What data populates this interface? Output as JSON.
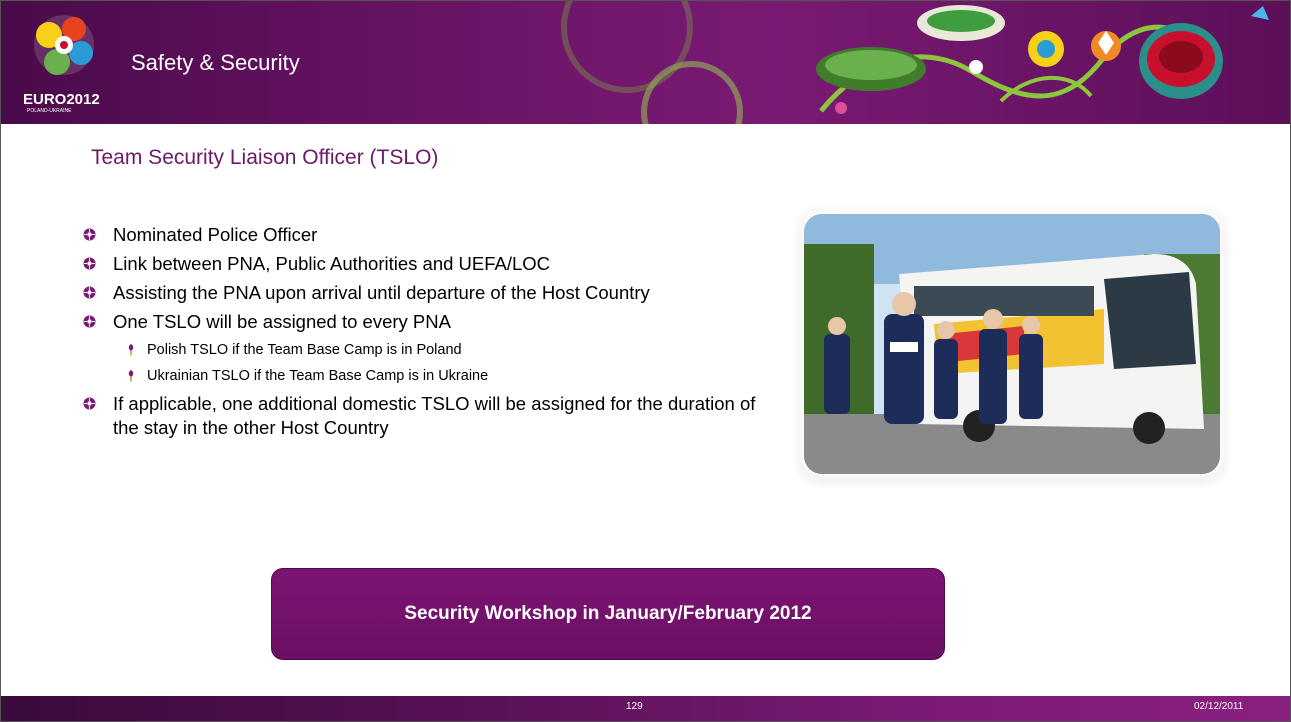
{
  "header": {
    "logo": {
      "name": "EURO2012",
      "subtitle": "POLAND-UKRAINE",
      "icon": "euro2012-logo"
    },
    "title": "Safety & Security"
  },
  "subtitle": "Team Security Liaison Officer (TSLO)",
  "bullets": [
    {
      "text": "Nominated Police Officer"
    },
    {
      "text": "Link between PNA, Public Authorities and UEFA/LOC"
    },
    {
      "text": "Assisting the PNA upon arrival until departure of the Host Country"
    },
    {
      "text": "One TSLO will be assigned to every PNA",
      "sub": [
        "Polish TSLO if the Team Base Camp is in Poland",
        "Ukrainian TSLO if the Team Base Camp is in Ukraine"
      ]
    },
    {
      "text": "If applicable, one additional domestic TSLO will be assigned for the duration of the stay in the other Host Country"
    }
  ],
  "photo": {
    "icon": "team-bus-police-photo"
  },
  "callout": "Security Workshop in January/February 2012",
  "footer": {
    "page": "129",
    "date": "02/12/2011"
  },
  "colors": {
    "brand": "#6b1a68",
    "callout": "#7c1473",
    "bullet": "#7a1a74"
  }
}
